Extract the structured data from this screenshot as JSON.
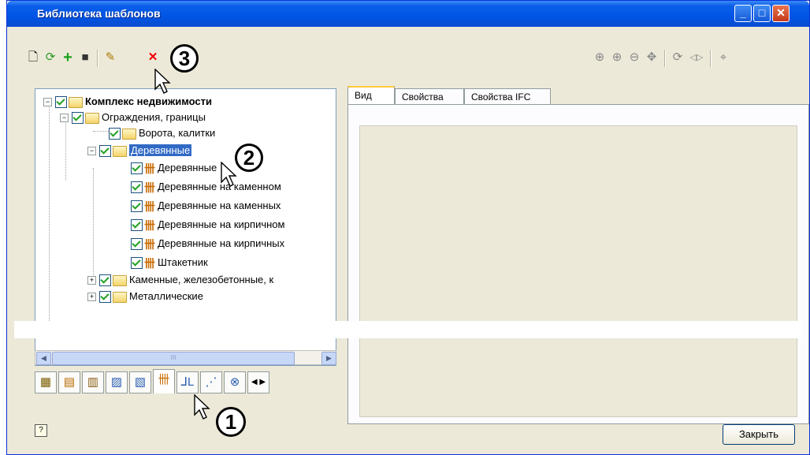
{
  "window": {
    "title": "Библиотека шаблонов"
  },
  "toolbar_left": [
    {
      "icon": "new-icon",
      "glyph": "🗋"
    },
    {
      "icon": "open-icon",
      "glyph": "⟳"
    },
    {
      "icon": "add-icon",
      "glyph": "+"
    },
    {
      "icon": "save-icon",
      "glyph": "■"
    },
    {
      "icon": "new-template-icon",
      "glyph": "✎"
    },
    {
      "icon": "delete-icon",
      "glyph": "✕"
    }
  ],
  "toolbar_right": [
    {
      "icon": "zoom-all-icon",
      "glyph": "⊕"
    },
    {
      "icon": "zoom-in-icon",
      "glyph": "⊕"
    },
    {
      "icon": "zoom-out-icon",
      "glyph": "⊖"
    },
    {
      "icon": "pan-icon",
      "glyph": "✥"
    },
    {
      "icon": "rotate-icon",
      "glyph": "⟳"
    },
    {
      "icon": "mirror-icon",
      "glyph": "◁▷"
    },
    {
      "icon": "center-icon",
      "glyph": "⌖"
    }
  ],
  "tree": {
    "root": "Комплекс недвижимости",
    "fences": "Ограждения, границы",
    "gates": "Ворота, калитки",
    "wooden": "Деревянные",
    "wooden_items": [
      "Деревянные",
      "Деревянные на каменном",
      "Деревянные на каменных",
      "Деревянные на кирпичном",
      "Деревянные на кирпичных",
      "Штакетник"
    ],
    "stone": "Каменные, железобетонные, к",
    "metal": "Металлические"
  },
  "scrollbar": {
    "thumb_grip": "III"
  },
  "tabs_right": [
    "Вид",
    "Свойства",
    "Свойства IFC"
  ],
  "footer": {
    "help": "?",
    "close_label": "Закрыть"
  },
  "callouts": [
    "1",
    "2",
    "3"
  ]
}
